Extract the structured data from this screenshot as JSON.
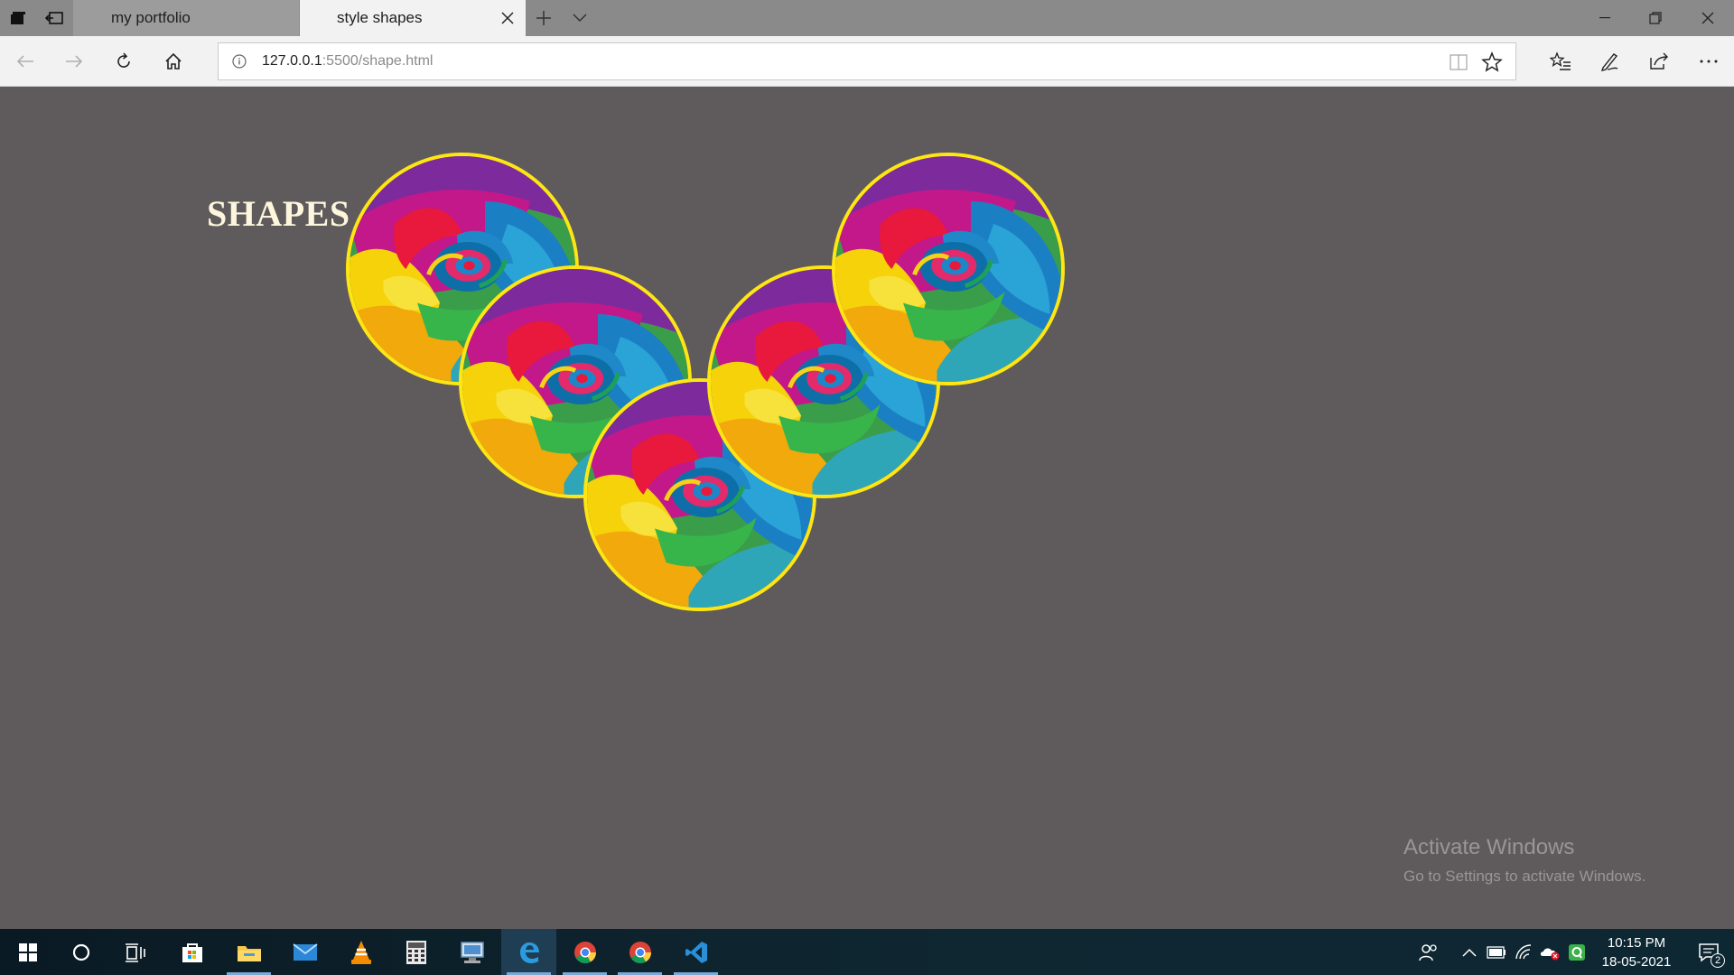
{
  "browser": {
    "tabs": [
      {
        "title": "my portfolio",
        "active": false
      },
      {
        "title": "style shapes",
        "active": true
      }
    ],
    "address": {
      "host": "127.0.0.1",
      "path": ":5500/shape.html"
    }
  },
  "page": {
    "heading": "SHAPES",
    "circles": [
      {
        "image": "rainbow-rose",
        "border_color": "#ffe514"
      },
      {
        "image": "rainbow-rose",
        "border_color": "#ffe514"
      },
      {
        "image": "rainbow-rose",
        "border_color": "#ffe514"
      },
      {
        "image": "rainbow-rose",
        "border_color": "#ffe514"
      },
      {
        "image": "rainbow-rose",
        "border_color": "#ffe514"
      }
    ],
    "background_color": "#5f5b5c"
  },
  "watermark": {
    "title": "Activate Windows",
    "subtitle": "Go to Settings to activate Windows."
  },
  "taskbar": {
    "apps": [
      "windows-start-icon",
      "cortana-icon",
      "task-view-icon",
      "store-icon",
      "file-explorer-icon",
      "mail-icon",
      "vlc-icon",
      "calculator-icon",
      "network-pc-icon",
      "edge-icon",
      "chrome-icon",
      "chrome-icon",
      "vscode-icon"
    ],
    "tray_icons": [
      "people-icon",
      "chevron-up-icon",
      "battery-icon",
      "wifi-icon",
      "onedrive-error-icon",
      "qbittorrent-icon"
    ],
    "time": "10:15 PM",
    "date": "18-05-2021",
    "notification_count": "2"
  }
}
